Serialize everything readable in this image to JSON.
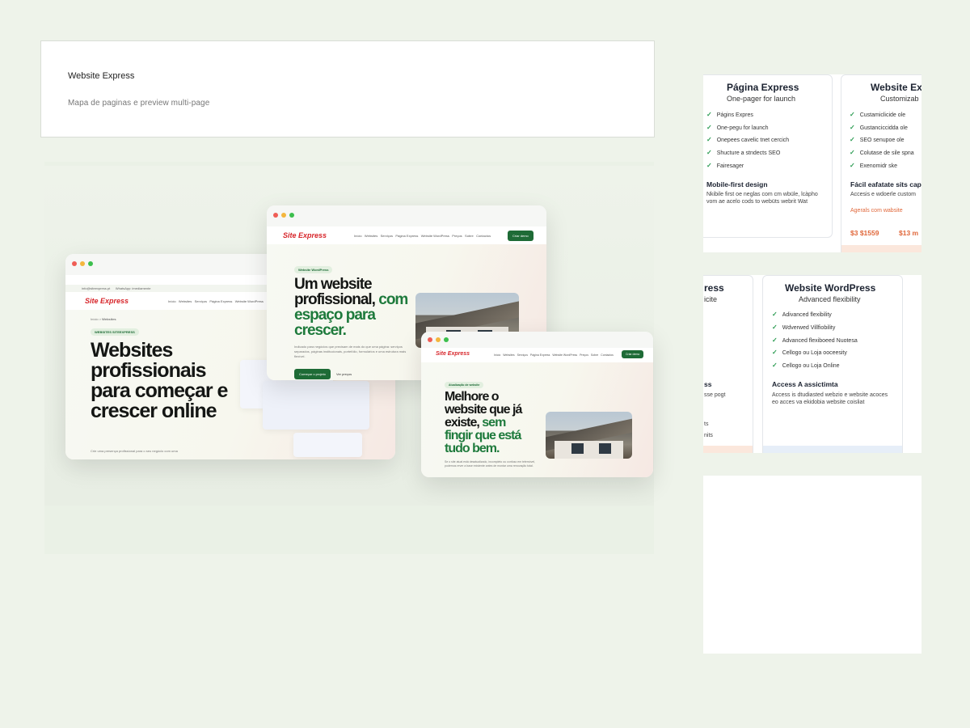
{
  "header_card": {
    "title": "Website Express",
    "subtitle": "Mapa de paginas e preview multi-page"
  },
  "site": {
    "logo": "Site Express",
    "topbar_email": "info@siteexpress.pt",
    "topbar_whatsapp": "WhatsApp: imediamente",
    "nav": [
      "Início",
      "Websites",
      "Serviços",
      "Página Express",
      "Website WordPress",
      "Preços",
      "Sobre",
      "Contactos"
    ],
    "cta": "Criar demo"
  },
  "win_back": {
    "crumb_home": "Início",
    "crumb_sep": ">",
    "crumb_current": "Websites",
    "eyebrow": "WEBSITES SITEEXPRESS",
    "headline": "Websites profissionais para começar e crescer online",
    "para": "Crie uma presença profissional para o seu negócio com uma"
  },
  "win_mid": {
    "eyebrow": "Website WordPress",
    "headline_black": "Um website profissional,",
    "headline_green": "com espaço para crescer.",
    "para": "Indicado para negócios que precisam de mais do que uma página: serviços separados, páginas institucionais, portefólio, formulários e uma estrutura mais flexível.",
    "btn_primary": "Começar o projeto",
    "btn_secondary": "Ver preços"
  },
  "win_front": {
    "eyebrow": "Atualização de website",
    "headline_black": "Melhore o website que já existe,",
    "headline_green": "sem fingir que está tudo bem.",
    "para": "Se o site atual está desatualizado, incompleto ou confuso em telemóvel, podemos rever a base existente antes de montar uma renovação total."
  },
  "pricing_top": {
    "left": {
      "title": "Página Express",
      "subtitle": "One-pager for launch",
      "features": [
        "Págins Expres",
        "One-pegu for launch",
        "Onepees cavelic tnet cercich",
        "Shucture a stndects SEO",
        "Fairesager"
      ],
      "section_title": "Mobile-first design",
      "section_text": "Nkibile first oe neglas com cm wbüle, lcàpho vom ae acelo cods to webüts webrit Wat"
    },
    "right": {
      "title": "Website Ex",
      "subtitle": "Customizab",
      "features": [
        "Custamiclicide ole",
        "Gustanciccidda ole",
        "SEO senupoe ole",
        "Colutase de sile spna",
        "Exenomidr ske"
      ],
      "section_title": "Fácil eafatate sits cap",
      "section_text": "Accesis e wdoerle custom",
      "price_label": "Agerals com wabsite",
      "prices": [
        "$3 $1559",
        "$13 m"
      ]
    }
  },
  "pricing_mid": {
    "left": {
      "title_fragment": "ress",
      "sub_fragment": "icite",
      "section_fragment": "ss",
      "text_fragments": [
        "sse pogt",
        "ts",
        "nits"
      ]
    },
    "right": {
      "title": "Website WordPress",
      "subtitle": "Advanced flexibility",
      "features": [
        "Adivanced flexibility",
        "Wdverwed Villfiobility",
        "Advanced flexiboeed Nuotesa",
        "Cellogo ou Loja ooceesity",
        "Cellogo ou Loja Online"
      ],
      "section_title": "Access A assictimta",
      "section_text": "Access is dtudiasted webzio e website acoces eo acces va ekidobia website coisliat"
    }
  },
  "colors": {
    "brand_green": "#1e6b36",
    "brand_red": "#d7262b",
    "price_orange": "#e0673a",
    "check_green": "#2a9b51"
  }
}
